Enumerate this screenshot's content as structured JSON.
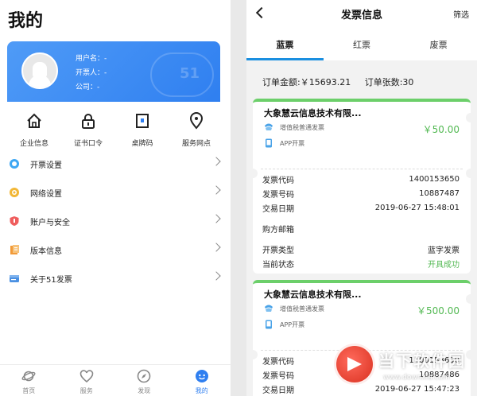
{
  "left": {
    "title": "我的",
    "card": {
      "username": "用户名：-",
      "issuer": "开票人：-",
      "company": "公司：-",
      "watermark": "51"
    },
    "quick": [
      {
        "label": "企业信息",
        "icon": "house-icon"
      },
      {
        "label": "证书口令",
        "icon": "lock-icon"
      },
      {
        "label": "桌牌码",
        "icon": "tablet-icon"
      },
      {
        "label": "服务网点",
        "icon": "location-pin-icon"
      }
    ],
    "menu": [
      {
        "label": "开票设置",
        "icon": "invoice-settings-icon",
        "color": "#3ea7f3"
      },
      {
        "label": "网络设置",
        "icon": "network-icon",
        "color": "#f2b736"
      },
      {
        "label": "账户与安全",
        "icon": "shield-icon",
        "color": "#ef5d5d"
      },
      {
        "label": "版本信息",
        "icon": "document-icon",
        "color": "#f29a38"
      },
      {
        "label": "关于51发票",
        "icon": "about-icon",
        "color": "#4a90e2"
      }
    ],
    "tabs": [
      {
        "label": "首页",
        "icon": "planet-icon"
      },
      {
        "label": "服务",
        "icon": "heart-icon"
      },
      {
        "label": "发现",
        "icon": "compass-icon"
      },
      {
        "label": "我的",
        "icon": "profile-face-icon",
        "active": true
      }
    ]
  },
  "right": {
    "title": "发票信息",
    "filter": "筛选",
    "tabs": [
      {
        "label": "蓝票",
        "active": true
      },
      {
        "label": "红票"
      },
      {
        "label": "废票"
      }
    ],
    "summary": {
      "amount": "订单金额:￥15693.21",
      "count": "订单张数:30"
    },
    "invoices": [
      {
        "company": "大象慧云信息技术有限...",
        "type": "增值税普通发票",
        "channel": "APP开票",
        "amount": "￥50.00",
        "rows": [
          {
            "k": "发票代码",
            "v": "1400153650"
          },
          {
            "k": "发票号码",
            "v": "10887487"
          },
          {
            "k": "交易日期",
            "v": "2019-06-27 15:48:01"
          },
          {
            "k": "购方邮箱",
            "v": ""
          },
          {
            "k": "开票类型",
            "v": "蓝字发票"
          },
          {
            "k": "当前状态",
            "v": "开具成功"
          }
        ]
      },
      {
        "company": "大象慧云信息技术有限...",
        "type": "增值税普通发票",
        "channel": "APP开票",
        "amount": "￥500.00",
        "rows": [
          {
            "k": "发票代码",
            "v": "1400153650"
          },
          {
            "k": "发票号码",
            "v": "10887486"
          },
          {
            "k": "交易日期",
            "v": "2019-06-27 15:47:23"
          }
        ]
      }
    ]
  },
  "watermark": {
    "text": "当下软件园",
    "url": "www.downxia.com"
  }
}
